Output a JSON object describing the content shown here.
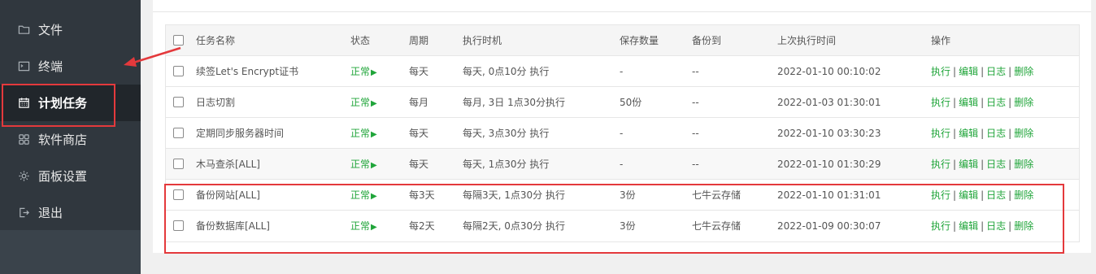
{
  "sidebar": {
    "items": [
      {
        "label": "文件",
        "icon": "folder-icon"
      },
      {
        "label": "终端",
        "icon": "terminal-icon"
      },
      {
        "label": "计划任务",
        "icon": "calendar-icon",
        "active": true
      },
      {
        "label": "软件商店",
        "icon": "grid-icon"
      },
      {
        "label": "面板设置",
        "icon": "gear-icon"
      },
      {
        "label": "退出",
        "icon": "logout-icon"
      }
    ]
  },
  "table": {
    "headers": {
      "name": "任务名称",
      "status": "状态",
      "cycle": "周期",
      "when": "执行时机",
      "keep": "保存数量",
      "dest": "备份到",
      "last": "上次执行时间",
      "ops": "操作"
    },
    "rows": [
      {
        "name": "续签Let's Encrypt证书",
        "status": "正常",
        "cycle": "每天",
        "when": "每天, 0点10分 执行",
        "keep": "-",
        "dest": "--",
        "last": "2022-01-10 00:10:02"
      },
      {
        "name": "日志切割",
        "status": "正常",
        "cycle": "每月",
        "when": "每月, 3日 1点30分执行",
        "keep": "50份",
        "dest": "--",
        "last": "2022-01-03 01:30:01"
      },
      {
        "name": "定期同步服务器时间",
        "status": "正常",
        "cycle": "每天",
        "when": "每天, 3点30分 执行",
        "keep": "-",
        "dest": "--",
        "last": "2022-01-10 03:30:23"
      },
      {
        "name": "木马查杀[ALL]",
        "status": "正常",
        "cycle": "每天",
        "when": "每天, 1点30分 执行",
        "keep": "-",
        "dest": "--",
        "last": "2022-01-10 01:30:29"
      },
      {
        "name": "备份网站[ALL]",
        "status": "正常",
        "cycle": "每3天",
        "when": "每隔3天, 1点30分 执行",
        "keep": "3份",
        "dest": "七牛云存储",
        "last": "2022-01-10 01:31:01"
      },
      {
        "name": "备份数据库[ALL]",
        "status": "正常",
        "cycle": "每2天",
        "when": "每隔2天, 0点30分 执行",
        "keep": "3份",
        "dest": "七牛云存储",
        "last": "2022-01-09 00:30:07"
      }
    ],
    "actions": {
      "run": "执行",
      "edit": "编辑",
      "log": "日志",
      "delete": "删除",
      "separator": "|"
    },
    "status_glyph": "▶"
  },
  "colors": {
    "sidebar_bg": "#30373e",
    "sidebar_active_bg": "#21262b",
    "accent_green": "#20a53a",
    "annotation_red": "#e4393c"
  }
}
